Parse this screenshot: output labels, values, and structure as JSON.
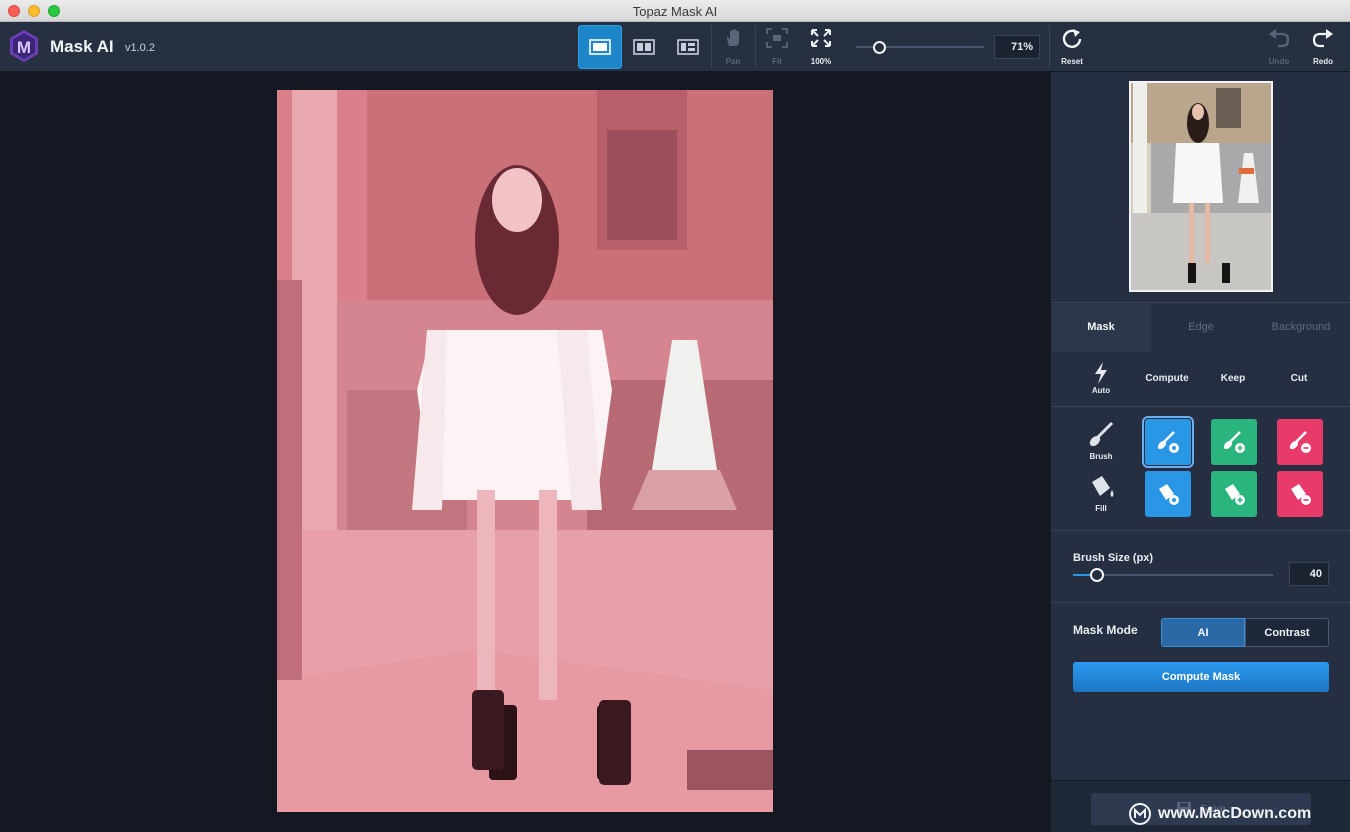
{
  "window": {
    "title": "Topaz Mask AI"
  },
  "app": {
    "name": "Mask AI",
    "version": "v1.0.2"
  },
  "toolbar": {
    "pan_label": "Pan",
    "fit_label": "Fit",
    "actual_label": "100%",
    "zoom_value": "71%",
    "reset_label": "Reset",
    "undo_label": "Undo",
    "redo_label": "Redo"
  },
  "panel": {
    "tabs": [
      "Mask",
      "Edge",
      "Background"
    ],
    "modes": {
      "auto": "Auto",
      "compute": "Compute",
      "keep": "Keep",
      "cut": "Cut"
    },
    "tools": {
      "brush": "Brush",
      "fill": "Fill"
    },
    "brush_size_label": "Brush Size (px)",
    "brush_size_value": "40",
    "mask_mode_label": "Mask Mode",
    "mask_mode_options": [
      "AI",
      "Contrast"
    ],
    "compute_button": "Compute Mask",
    "save_button": "Save"
  },
  "watermark": {
    "text": "www.MacDown.com"
  },
  "colors": {
    "accent": "#2a97e6",
    "keep": "#2bb57e",
    "cut": "#e83a6a",
    "mask_overlay": "#e8506a"
  }
}
